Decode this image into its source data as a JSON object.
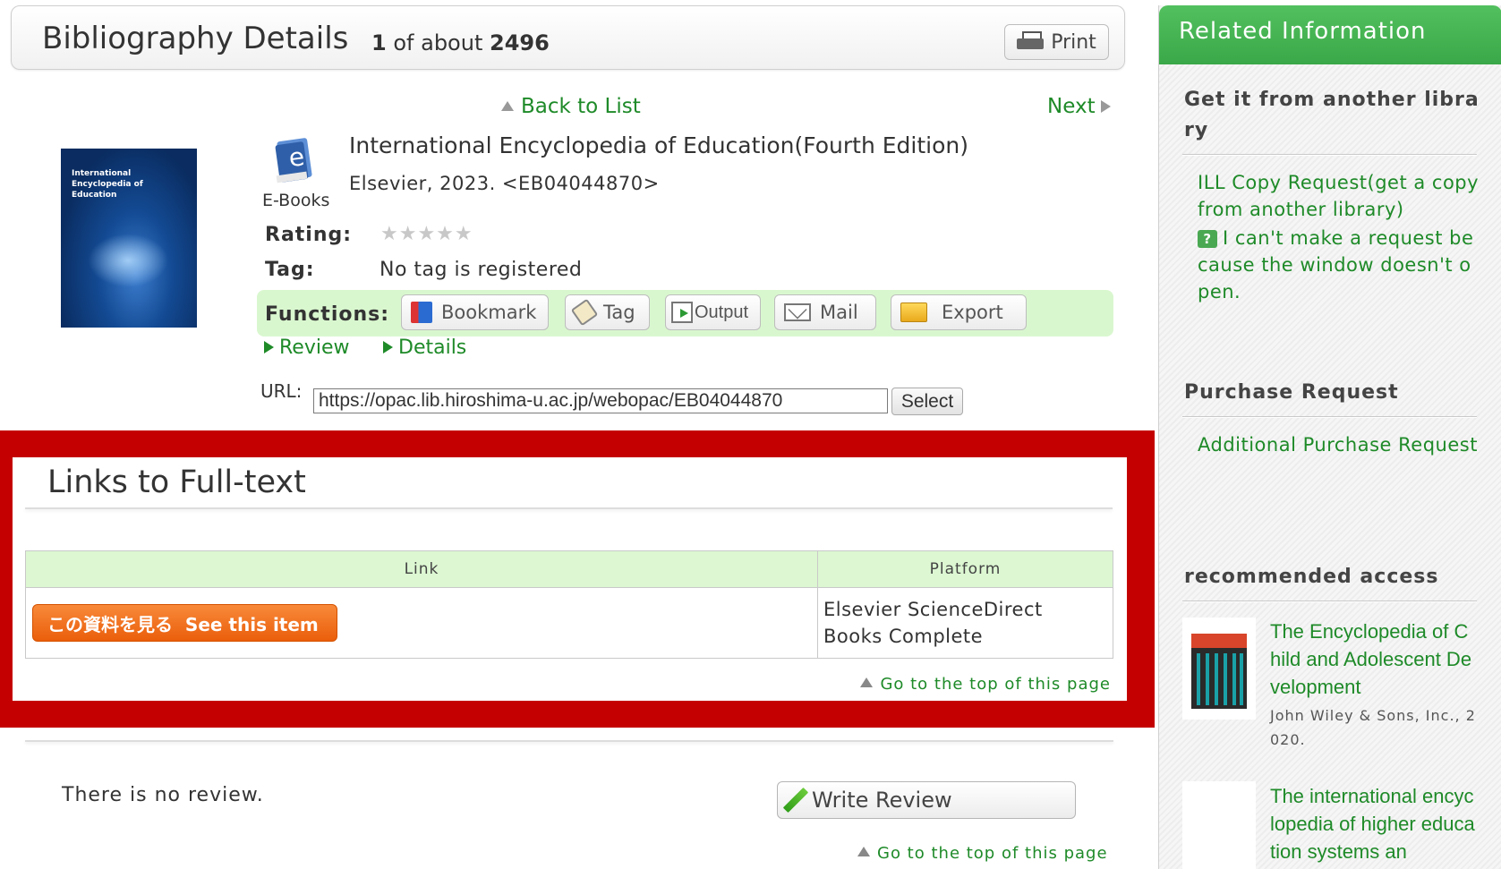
{
  "header": {
    "title": "Bibliography Details",
    "count_prefix": "1",
    "count_mid": "of about",
    "count_total": "2496",
    "print_label": "Print"
  },
  "nav": {
    "back_to_list": "Back to List",
    "next": "Next"
  },
  "book": {
    "cover_title": "International Encyclopedia of Education",
    "type_label": "E-Books",
    "title": "International Encyclopedia of Education(Fourth Edition)",
    "publisher_line": "Elsevier, 2023. <EB04044870>",
    "rating_label": "Rating:",
    "rating_stars": "★★★★★",
    "rating_value": 0,
    "tag_label": "Tag:",
    "tag_value": "No tag is registered"
  },
  "functions": {
    "label": "Functions:",
    "bookmark": "Bookmark",
    "tag": "Tag",
    "output": "Output",
    "mail": "Mail",
    "export": "Export"
  },
  "links": {
    "review": "Review",
    "details": "Details"
  },
  "url": {
    "label": "URL:",
    "value": "https://opac.lib.hiroshima-u.ac.jp/webopac/EB04044870",
    "select_label": "Select"
  },
  "fulltext": {
    "title": "Links to Full-text",
    "columns": [
      "Link",
      "Platform"
    ],
    "rows": [
      {
        "button_label": "この資料を見る  See this item",
        "platform": "Elsevier ScienceDirect Books Complete"
      }
    ],
    "top_link": "Go to the top of this page"
  },
  "review_section": {
    "no_review": "There is no review.",
    "write_review": "Write Review",
    "top_link": "Go to the top of this page"
  },
  "sidebar": {
    "header": "Related Information",
    "another_library": {
      "heading": "Get it from another library",
      "ill_link": "ILL Copy Request(get a copy from another library)",
      "help_text": "I can't make a request because the window doesn't open."
    },
    "purchase": {
      "heading": "Purchase Request",
      "link": "Additional Purchase Request"
    },
    "recommended": {
      "heading": "recommended access",
      "items": [
        {
          "title": "The Encyclopedia of Child and Adolescent Development",
          "publisher": "John Wiley & Sons, Inc., 2020."
        },
        {
          "title": "The international encyclopedia of higher education systems an",
          "publisher": ""
        }
      ]
    }
  },
  "colors": {
    "accent_green": "#1e8a28",
    "highlight_red": "#c40000",
    "sidebar_header": "#46b452",
    "see_item_orange": "#f06a16"
  }
}
